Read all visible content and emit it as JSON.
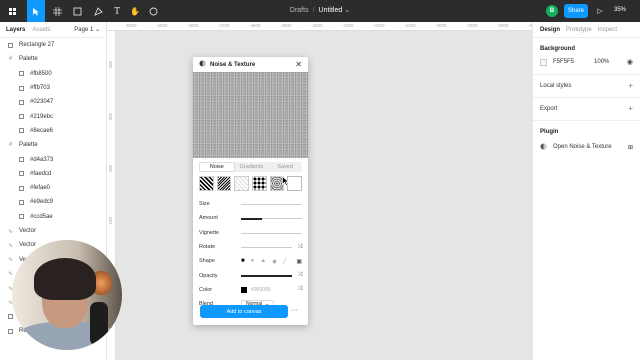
{
  "toolbar": {
    "tools": [
      "figma-menu-icon",
      "move-tool-icon",
      "frame-tool-icon",
      "shape-tool-icon",
      "pen-tool-icon",
      "text-tool-icon",
      "hand-tool-icon",
      "comment-tool-icon"
    ],
    "breadcrumb_parent": "Drafts",
    "breadcrumb_sep": "/",
    "file_name": "Untitled",
    "user_initial": "B",
    "share_label": "Share",
    "zoom": "35%"
  },
  "ruler": {
    "top": [
      "-5000",
      "-4900",
      "-4800",
      "-4700",
      "-4600",
      "-4500",
      "-4400",
      "-4300",
      "-4200",
      "-4100",
      "-4000",
      "-3900",
      "-3800",
      "-3700"
    ],
    "left": [
      "400",
      "300",
      "200",
      "100",
      "0",
      "100"
    ]
  },
  "left_panel": {
    "tab_layers": "Layers",
    "tab_assets": "Assets",
    "page": "Page 1",
    "layers": [
      {
        "name": "Rectangle 27",
        "kind": "rect",
        "indent": 0
      },
      {
        "name": "Palette",
        "kind": "frame",
        "indent": 0
      },
      {
        "name": "#fb8500",
        "kind": "rect",
        "indent": 1
      },
      {
        "name": "#ffb703",
        "kind": "rect",
        "indent": 1
      },
      {
        "name": "#023047",
        "kind": "rect",
        "indent": 1
      },
      {
        "name": "#219ebc",
        "kind": "rect",
        "indent": 1
      },
      {
        "name": "#8ecae6",
        "kind": "rect",
        "indent": 1
      },
      {
        "name": "Palette",
        "kind": "frame",
        "indent": 0
      },
      {
        "name": "#d4a373",
        "kind": "rect",
        "indent": 1
      },
      {
        "name": "#faedcd",
        "kind": "rect",
        "indent": 1
      },
      {
        "name": "#fefae0",
        "kind": "rect",
        "indent": 1
      },
      {
        "name": "#e9edc9",
        "kind": "rect",
        "indent": 1
      },
      {
        "name": "#ccd5ae",
        "kind": "rect",
        "indent": 1
      },
      {
        "name": "Vector",
        "kind": "vector",
        "indent": 0
      },
      {
        "name": "Vector",
        "kind": "vector",
        "indent": 0
      },
      {
        "name": "Vector",
        "kind": "vector",
        "indent": 0
      },
      {
        "name": "Vector",
        "kind": "vector",
        "indent": 0
      },
      {
        "name": "Vector",
        "kind": "vector",
        "indent": 0
      },
      {
        "name": "Vector",
        "kind": "vector",
        "indent": 0
      },
      {
        "name": "Rectangle",
        "kind": "rect",
        "indent": 0
      },
      {
        "name": "Rectangle",
        "kind": "rect",
        "indent": 0
      }
    ]
  },
  "right_panel": {
    "tab_design": "Design",
    "tab_prototype": "Prototype",
    "tab_inspect": "Inspect",
    "background_title": "Background",
    "background_hex": "F5F5F5",
    "background_opacity": "100%",
    "background_color": "#f5f5f5",
    "local_styles": "Local styles",
    "export": "Export",
    "plugin_title": "Plugin",
    "plugin_name": "Open Noise & Texture"
  },
  "plugin": {
    "title": "Noise & Texture",
    "tabs": [
      "Noise",
      "Gradients",
      "Saved"
    ],
    "active_tab": "Noise",
    "size_label": "Size",
    "amount_label": "Amount",
    "amount_value": 0.35,
    "vignette_label": "Vignette",
    "rotate_label": "Rotate",
    "shape_label": "Shape",
    "opacity_label": "Opacity",
    "opacity_value": 1.0,
    "color_label": "Color",
    "color_hex": "#000000",
    "blend_label": "Blend",
    "blend_value": "Normal",
    "add_button": "Add to canvas",
    "more": "···"
  },
  "colors": {
    "accent": "#0d99ff",
    "toolbar_bg": "#2c2c2c",
    "user_avatar": "#14ae5c"
  }
}
